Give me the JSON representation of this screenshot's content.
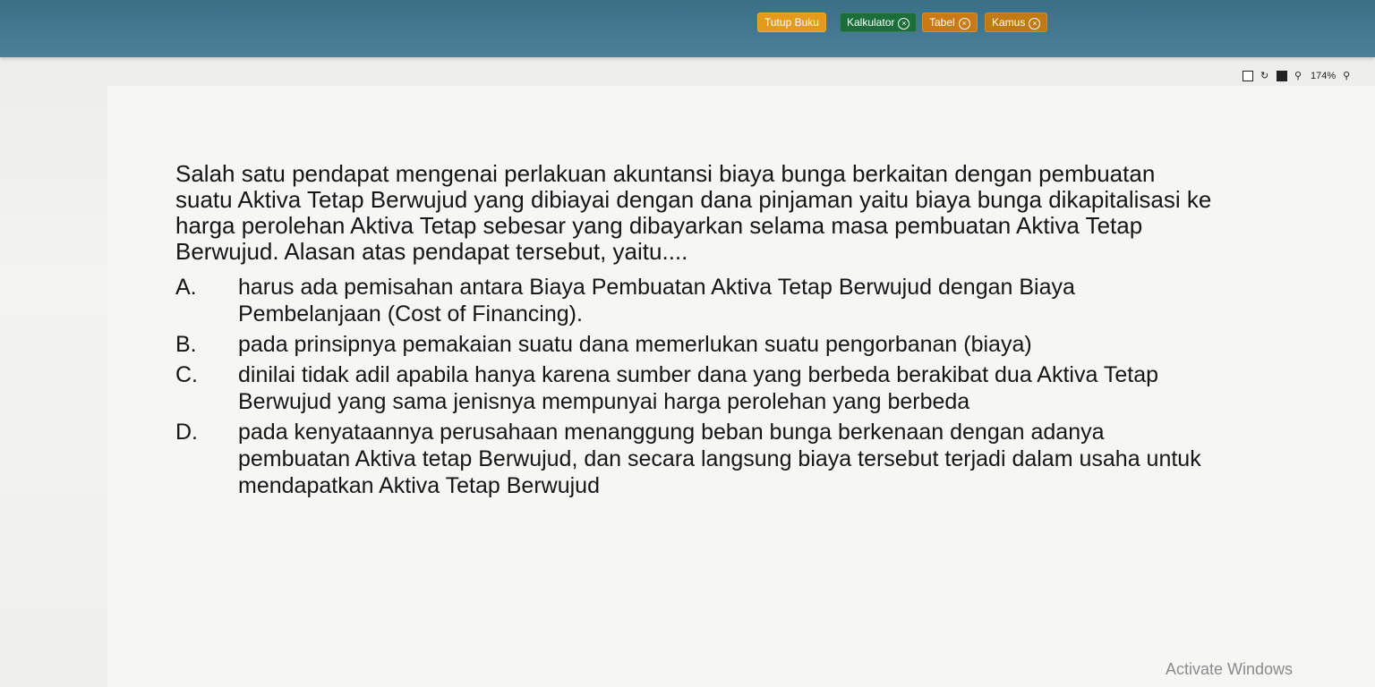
{
  "toolbar": {
    "tutup_buku": "Tutup Buku",
    "kalkulator": "Kalkulator",
    "tabel": "Tabel",
    "kamus": "Kamus",
    "zoom": "174%"
  },
  "question": {
    "stem": "Salah satu pendapat mengenai perlakuan akuntansi biaya bunga berkaitan dengan pembuatan suatu Aktiva Tetap Berwujud yang dibiayai dengan dana pinjaman yaitu biaya bunga dikapitalisasi ke harga perolehan Aktiva Tetap sebesar yang dibayarkan selama masa pembuatan Aktiva Tetap Berwujud. Alasan atas pendapat tersebut, yaitu....",
    "options": [
      {
        "letter": "A.",
        "text": "harus ada pemisahan antara Biaya Pembuatan Aktiva Tetap Berwujud dengan Biaya Pembelanjaan (Cost of Financing)."
      },
      {
        "letter": "B.",
        "text": "pada prinsipnya pemakaian suatu dana memerlukan suatu pengorbanan (biaya)"
      },
      {
        "letter": "C.",
        "text": "dinilai tidak adil apabila hanya karena sumber dana yang berbeda berakibat dua Aktiva Tetap Berwujud yang sama jenisnya mempunyai harga perolehan yang berbeda"
      },
      {
        "letter": "D.",
        "text": "pada kenyataannya perusahaan menanggung beban bunga berkenaan dengan adanya pembuatan Aktiva tetap Berwujud, dan secara langsung biaya tersebut terjadi dalam usaha untuk mendapatkan Aktiva Tetap Berwujud"
      }
    ]
  },
  "watermark": "Activate Windows"
}
